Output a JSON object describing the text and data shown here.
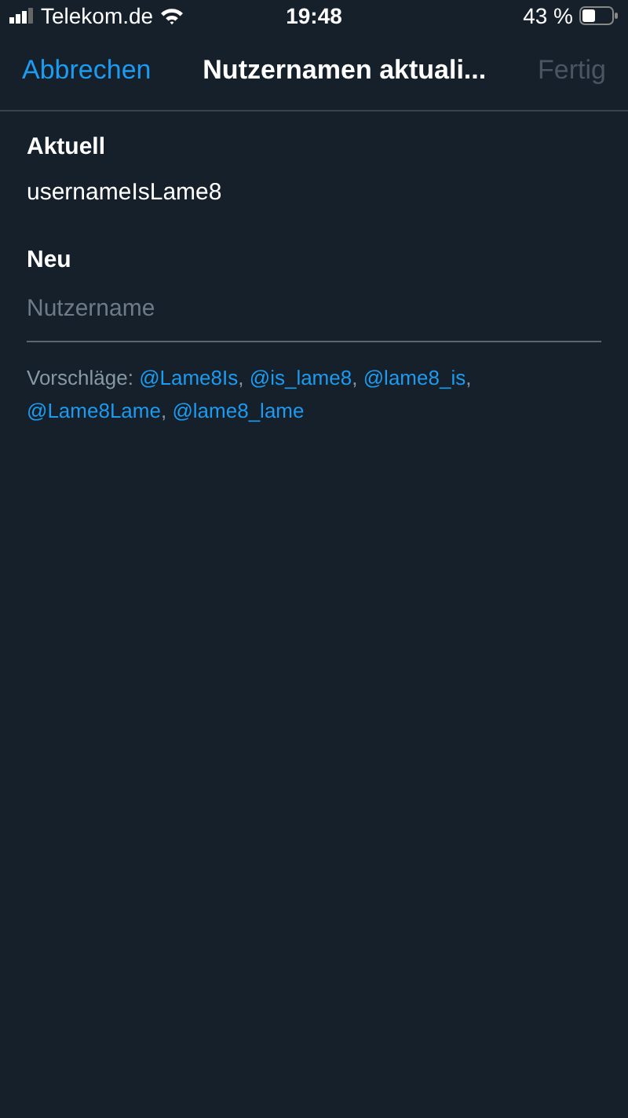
{
  "status_bar": {
    "carrier": "Telekom.de",
    "time": "19:48",
    "battery": "43 %"
  },
  "nav": {
    "cancel": "Abbrechen",
    "title": "Nutzernamen aktuali...",
    "done": {
      "label": "Fertig",
      "disabled": true
    }
  },
  "current": {
    "label": "Aktuell",
    "value": "usernameIsLame8"
  },
  "new": {
    "label": "Neu",
    "placeholder": "Nutzername"
  },
  "suggestions": {
    "prefix": "Vorschläge:",
    "items": [
      {
        "handle": "@Lame8Is",
        "separator": ","
      },
      {
        "handle": "@is_lame8",
        "separator": ","
      },
      {
        "handle": "@lame8_is",
        "separator": ","
      },
      {
        "handle": "@Lame8Lame",
        "separator": ","
      },
      {
        "handle": "@lame8_lame"
      }
    ]
  }
}
